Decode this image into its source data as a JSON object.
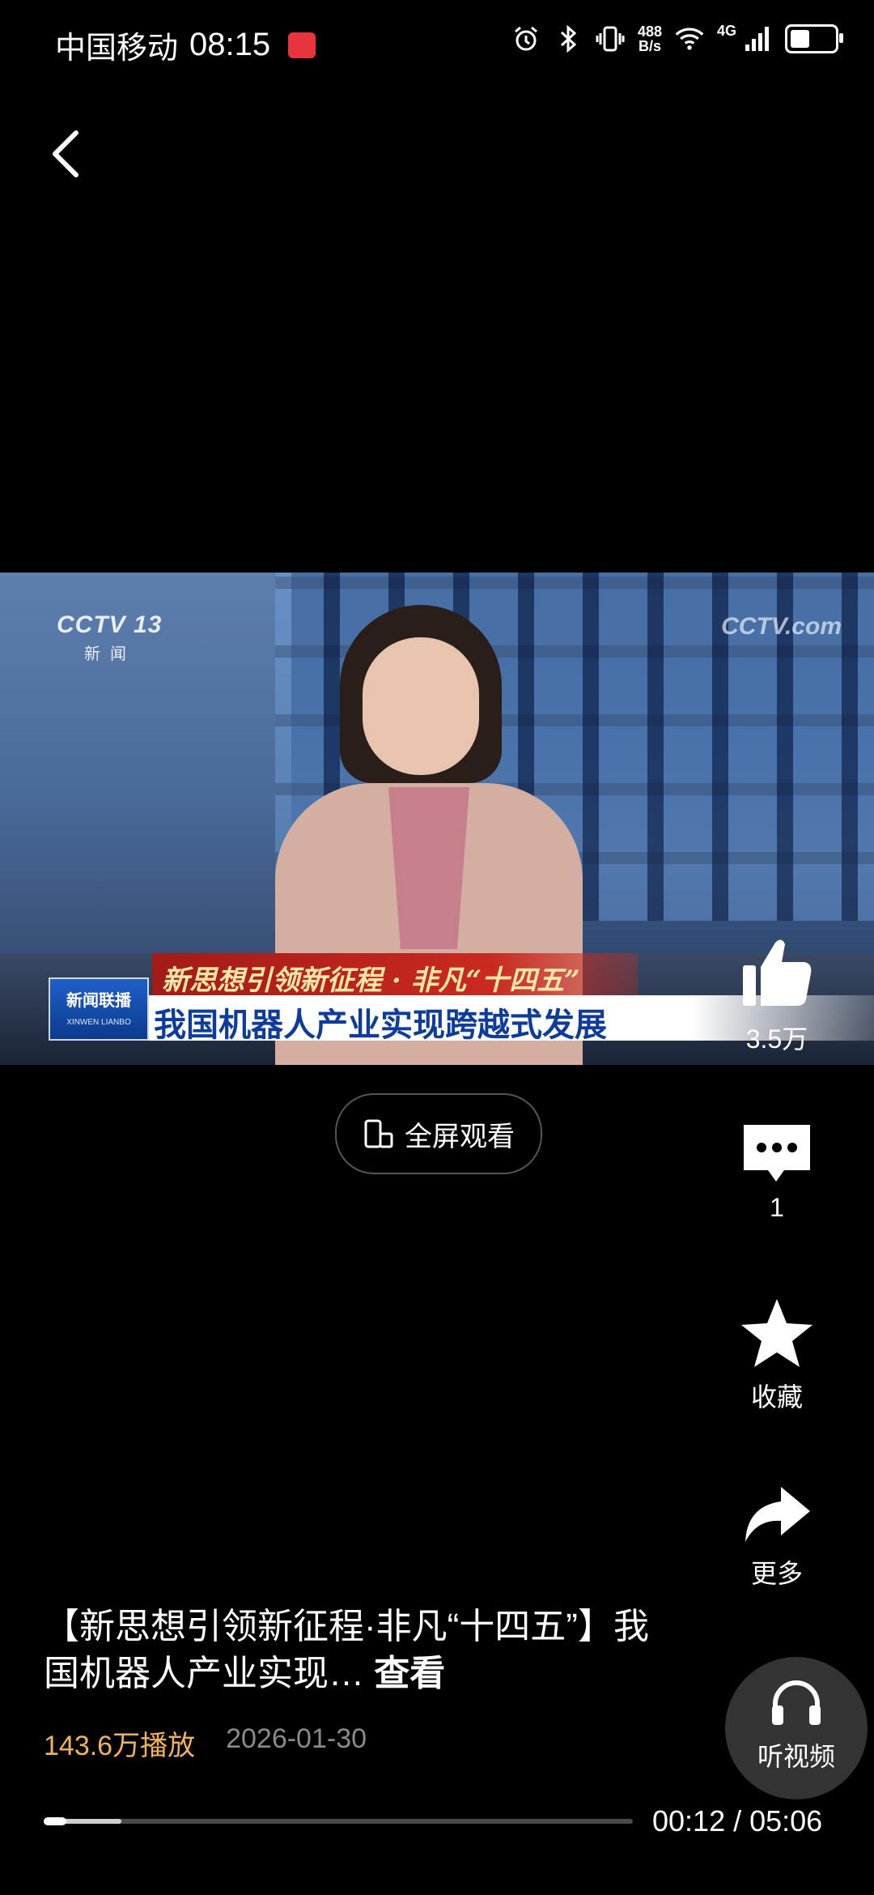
{
  "status_bar": {
    "carrier": "中国移动",
    "time": "08:15",
    "net_speed_value": "488",
    "net_speed_unit": "B/s",
    "network_type": "4G",
    "battery_level": 0.45
  },
  "video": {
    "channel_logo": "CCTV 13",
    "channel_sub": "新闻",
    "watermark": "CCTV.com",
    "program_logo": "新闻联播",
    "program_logo_sub": "XINWEN LIANBO",
    "banner_top": "新思想引领新征程 · 非凡“十四五”",
    "banner_bottom": "我国机器人产业实现跨越式发展",
    "progress": 0.039
  },
  "fullscreen_button": {
    "label": "全屏观看"
  },
  "actions": {
    "like_count": "3.5万",
    "comment_count": "1",
    "favorite_label": "收藏",
    "more_label": "更多",
    "listen_label": "听视频"
  },
  "caption": {
    "text": "【新思想引领新征程·非凡“十四五”】我国机器人产业实现…",
    "expand_label": "查看"
  },
  "meta": {
    "plays": "143.6万播放",
    "date": "2026-01-30"
  },
  "player": {
    "time": "00:12 / 05:06"
  },
  "colors": {
    "plays": "#f0b35c",
    "banner_red": "#c92a20",
    "banner_blue_text": "#0d3c9c"
  }
}
